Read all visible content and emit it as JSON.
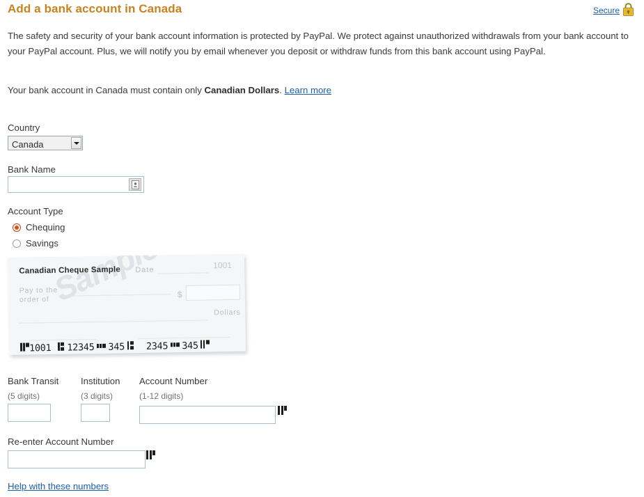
{
  "header": {
    "title": "Add a bank account in Canada",
    "secure_label": "Secure",
    "secure_icon": "padlock-icon",
    "title_color": "#c8821e"
  },
  "intro": {
    "paragraph": "The safety and security of your bank account information is protected by PayPal. We protect against unauthorized withdrawals from your bank account to your PayPal account. Plus, we will notify you by email whenever you deposit or withdraw funds from this bank account using PayPal.",
    "currency_prefix": "Your bank account in Canada must contain only ",
    "currency_bold": "Canadian Dollars",
    "currency_suffix": ". ",
    "learn_more": "Learn more"
  },
  "form": {
    "country": {
      "label": "Country",
      "value": "Canada",
      "options": [
        "Canada"
      ]
    },
    "bank_name": {
      "label": "Bank Name",
      "value": "",
      "placeholder": "",
      "button_icon": "bank-lookup-icon"
    },
    "account_type": {
      "label": "Account Type",
      "options": [
        {
          "label": "Chequing",
          "selected": true
        },
        {
          "label": "Savings",
          "selected": false
        }
      ]
    },
    "bank_transit": {
      "label": "Bank Transit",
      "hint": "(5 digits)",
      "value": "",
      "placeholder": ""
    },
    "institution": {
      "label": "Institution",
      "hint": "(3 digits)",
      "value": "",
      "placeholder": ""
    },
    "account_number": {
      "label": "Account Number",
      "hint": "(1-12 digits)",
      "value": "",
      "placeholder": "",
      "marker_icon": "micr-symbol-icon"
    },
    "reenter_account_number": {
      "label": "Re-enter Account Number",
      "value": "",
      "placeholder": "",
      "marker_icon": "micr-symbol-icon"
    },
    "help_link": "Help with these numbers"
  },
  "cheque_sample": {
    "title": "Canadian Cheque Sample",
    "date_label": "Date",
    "cheque_number": "1001",
    "pay_to_line1": "Pay to the",
    "pay_to_line2": "order of",
    "dollar_sign": "$",
    "dollars_label": "Dollars",
    "watermark": "Sample",
    "micr": {
      "cheque_no": "1001",
      "transit": "12345",
      "institution": "345",
      "account_part1": "2345",
      "account_part2": "345"
    }
  },
  "colors": {
    "title": "#c8821e",
    "link": "#1b5faa",
    "body_text": "#3a3a3a",
    "hint_text": "#737373",
    "input_border": "#a8bdd1",
    "radio_selected": "#d2521d",
    "lock": "#e8b931"
  }
}
